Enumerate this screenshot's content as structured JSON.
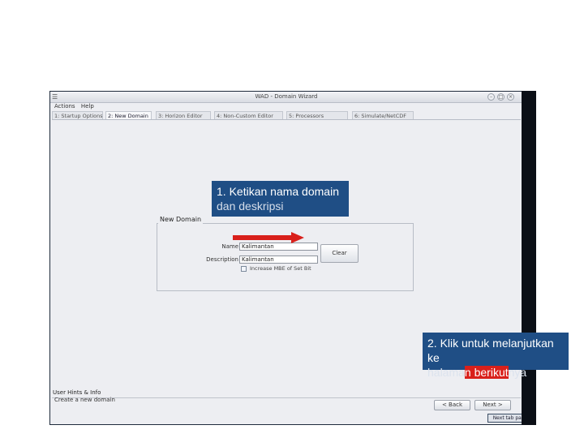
{
  "window": {
    "title": "WAD - Domain Wizard",
    "menu": [
      "Actions",
      "Help"
    ]
  },
  "tabs": [
    {
      "label": "1: Startup Options",
      "active": false
    },
    {
      "label": "2: New Domain",
      "active": true
    },
    {
      "label": "3: Horizon Editor",
      "active": false
    },
    {
      "label": "4: Non-Custom Editor",
      "active": false
    },
    {
      "label": "5: Processors",
      "active": false
    },
    {
      "label": "6: Simulate/NetCDF",
      "active": false
    }
  ],
  "new_domain": {
    "group_title": "New Domain",
    "name_label": "Name",
    "name_value": "Kalimantan",
    "description_label": "Description",
    "description_value": "Kalimantan",
    "clear_label": "Clear",
    "checkbox_label": "Increase MBE of Set Bit"
  },
  "hints": {
    "header": "User Hints & Info",
    "text": "Create a new domain"
  },
  "navigation": {
    "back_label": "< Back",
    "next_label": "Next >",
    "tooltip": "Next tab page"
  },
  "callouts": {
    "one_main": "1. Ketikan nama domain",
    "one_overflow": "dan deskripsi",
    "two_main": "2. Klik untuk melanjutkan ke",
    "two_overflow_a": "halama",
    "two_overflow_hl": "n berikut",
    "two_overflow_b": "nya"
  },
  "colors": {
    "callout_bg": "#1f4e85",
    "arrow": "#d9201b",
    "window_bg": "#edeef2"
  }
}
